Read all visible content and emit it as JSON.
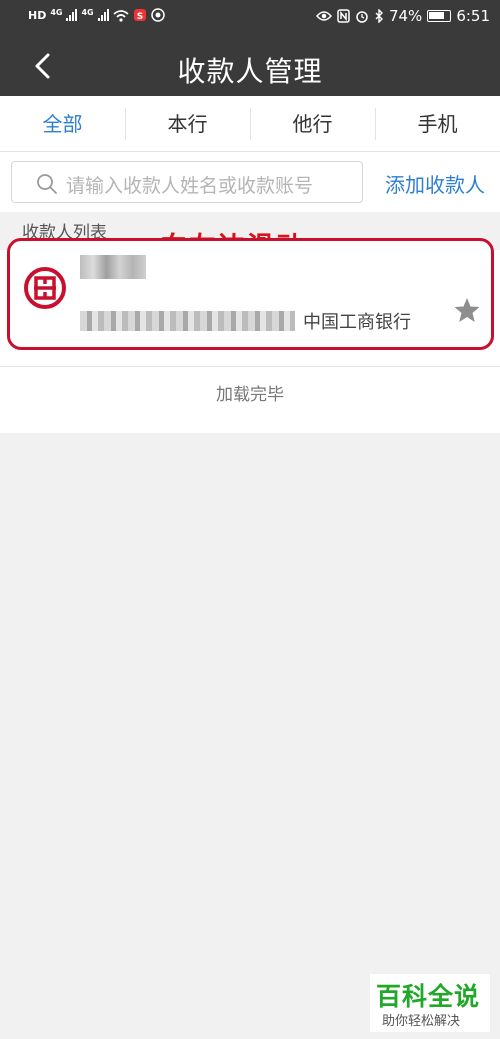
{
  "status_bar": {
    "network_labels": [
      "HD",
      "4G",
      "4G"
    ],
    "battery": "74%",
    "time": "6:51",
    "icons": [
      "eye-icon",
      "nfc-icon",
      "alarm-icon",
      "bluetooth-icon",
      "battery-icon"
    ]
  },
  "header": {
    "title": "收款人管理",
    "back_icon": "chevron-left-icon"
  },
  "tabs": [
    {
      "label": "全部",
      "active": true
    },
    {
      "label": "本行",
      "active": false
    },
    {
      "label": "他行",
      "active": false
    },
    {
      "label": "手机",
      "active": false
    }
  ],
  "search": {
    "placeholder": "请输入收款人姓名或收款账号",
    "add_label": "添加收款人"
  },
  "list": {
    "section_title": "收款人列表",
    "annotation": "向左边滑动",
    "items": [
      {
        "bank_name": "中国工商银行",
        "bank_icon": "icbc-logo-icon",
        "favorite_icon": "star-icon"
      }
    ],
    "footer": "加载完毕"
  },
  "watermark": {
    "title": "百科全说",
    "subtitle": "助你轻松解决"
  },
  "colors": {
    "header_bg": "#3a3a3a",
    "accent": "#2f7fd0",
    "highlight": "#c8102e",
    "annotation": "#d81418",
    "watermark": "#21a829"
  }
}
